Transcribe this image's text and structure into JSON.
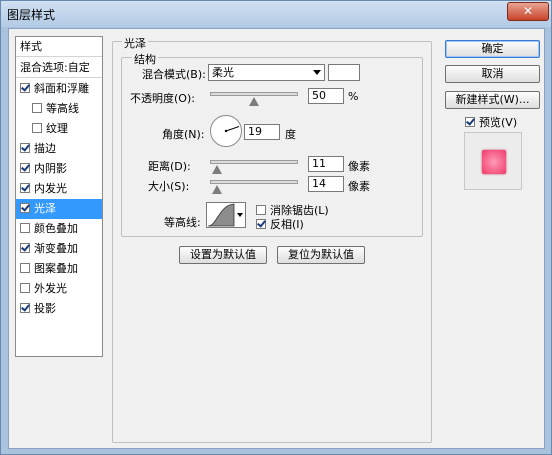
{
  "window": {
    "title": "图层样式",
    "close_label": "✕"
  },
  "sidebar": {
    "header": "样式",
    "blend_options": "混合选项:自定",
    "items": [
      {
        "label": "斜面和浮雕",
        "checked": true,
        "indent": false
      },
      {
        "label": "等高线",
        "checked": false,
        "indent": true
      },
      {
        "label": "纹理",
        "checked": false,
        "indent": true
      },
      {
        "label": "描边",
        "checked": true,
        "indent": false
      },
      {
        "label": "内阴影",
        "checked": true,
        "indent": false
      },
      {
        "label": "内发光",
        "checked": true,
        "indent": false
      },
      {
        "label": "光泽",
        "checked": true,
        "indent": false,
        "selected": true
      },
      {
        "label": "颜色叠加",
        "checked": false,
        "indent": false
      },
      {
        "label": "渐变叠加",
        "checked": true,
        "indent": false
      },
      {
        "label": "图案叠加",
        "checked": false,
        "indent": false
      },
      {
        "label": "外发光",
        "checked": false,
        "indent": false
      },
      {
        "label": "投影",
        "checked": true,
        "indent": false
      }
    ]
  },
  "satin": {
    "group_title": "光泽",
    "structure_title": "结构",
    "blend_mode_label": "混合模式(B):",
    "blend_mode_value": "柔光",
    "opacity_label": "不透明度(O):",
    "opacity_value": "50",
    "opacity_unit": "%",
    "opacity_fraction": 0.5,
    "angle_label": "角度(N):",
    "angle_value": "19",
    "angle_unit": "度",
    "distance_label": "距离(D):",
    "distance_value": "11",
    "distance_unit": "像素",
    "size_label": "大小(S):",
    "size_value": "14",
    "size_unit": "像素",
    "contour_label": "等高线:",
    "antialias_label": "消除锯齿(L)",
    "antialias_checked": false,
    "invert_label": "反相(I)",
    "invert_checked": true,
    "make_default_label": "设置为默认值",
    "reset_default_label": "复位为默认值"
  },
  "buttons": {
    "ok_label": "确定",
    "cancel_label": "取消",
    "new_style_label": "新建样式(W)...",
    "preview_label": "预览(V)",
    "preview_checked": true
  },
  "colors": {
    "selection": "#3399ff",
    "swatch": "#ffffff",
    "preview": "#f0507a"
  }
}
